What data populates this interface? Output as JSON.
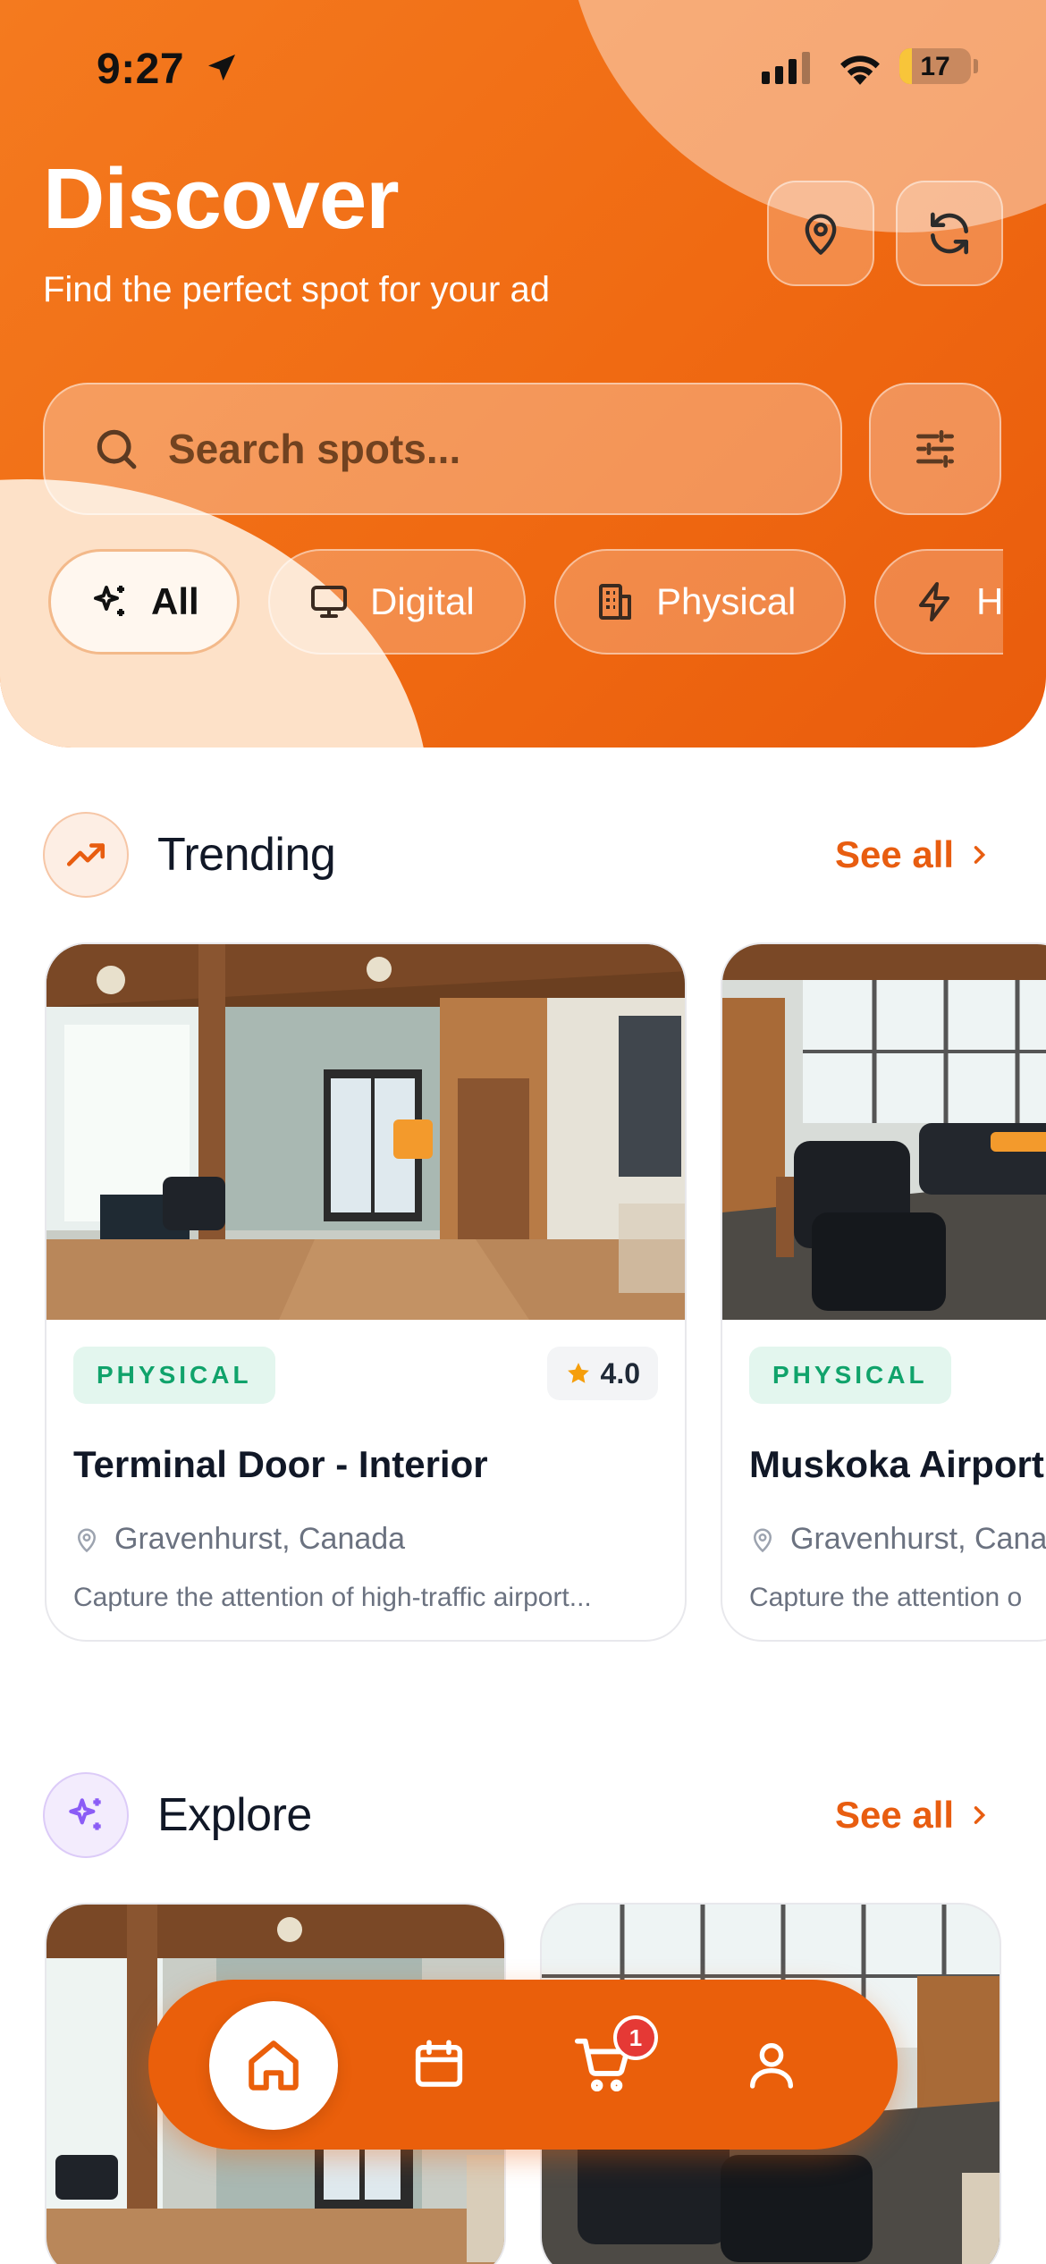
{
  "status_bar": {
    "time": "9:27",
    "battery": "17",
    "battery_level": 0.17
  },
  "header": {
    "title": "Discover",
    "subtitle": "Find the perfect spot for your ad",
    "location_icon": "map-pin-icon",
    "refresh_icon": "refresh-icon"
  },
  "search": {
    "placeholder": "Search spots...",
    "icon": "search-icon",
    "filter_icon": "sliders-icon"
  },
  "filters": [
    {
      "label": "All",
      "icon": "sparkles-icon",
      "active": true
    },
    {
      "label": "Digital",
      "icon": "monitor-icon",
      "active": false
    },
    {
      "label": "Physical",
      "icon": "building-icon",
      "active": false
    },
    {
      "label": "H",
      "icon": "lightning-icon",
      "active": false
    }
  ],
  "trending": {
    "title": "Trending",
    "see_all": "See all",
    "icon": "trending-up-icon",
    "cards": [
      {
        "badge": "PHYSICAL",
        "rating": "4.0",
        "title": "Terminal Door - Interior",
        "location": "Gravenhurst, Canada",
        "description": "Capture the attention of high-traffic airport..."
      },
      {
        "badge": "PHYSICAL",
        "title": "Muskoka Airport",
        "location": "Gravenhurst, Canada",
        "description": "Capture the attention o"
      }
    ]
  },
  "explore": {
    "title": "Explore",
    "see_all": "See all",
    "icon": "sparkles-icon"
  },
  "bottom_nav": {
    "items": [
      "home-icon",
      "calendar-icon",
      "cart-icon",
      "user-icon"
    ],
    "cart_count": "1"
  },
  "colors": {
    "accent": "#ea5f0b",
    "badge_green": "#10a36b",
    "star": "#f59e0b"
  }
}
